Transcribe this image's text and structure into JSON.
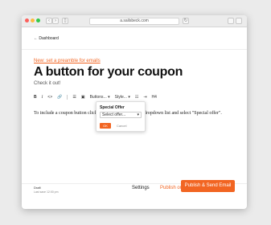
{
  "browser": {
    "url": "a.sailsbeck.com"
  },
  "header": {
    "back_label": "Dashboard"
  },
  "editor": {
    "preamble_link": "New: set a preamble for emails",
    "title": "A button for your coupon",
    "subtitle": "Check it out!",
    "toolbar": {
      "bold": "B",
      "italic": "I",
      "code": "<>",
      "link": "🔗",
      "list_bullets": "☰",
      "image": "▣",
      "buttons_label": "Buttons...",
      "styles_label": "Style...",
      "numbered": "☷",
      "indent": "⇥",
      "h4": "H4"
    },
    "body_text": "To include a coupon button click on, go to the \"Buttons\" dropdown list and select \"Special offer\"."
  },
  "popup": {
    "title": "Special Offer",
    "select_value": "Select offer...",
    "ok_label": "OK",
    "cancel_label": "Cancel"
  },
  "footer": {
    "status": "Draft",
    "last_save": "Last save 12:00 pm",
    "settings_label": "Settings",
    "publish_web_label": "Publish on Website",
    "publish_send_label": "Publish & Send Email"
  },
  "colors": {
    "accent": "#f26522"
  }
}
